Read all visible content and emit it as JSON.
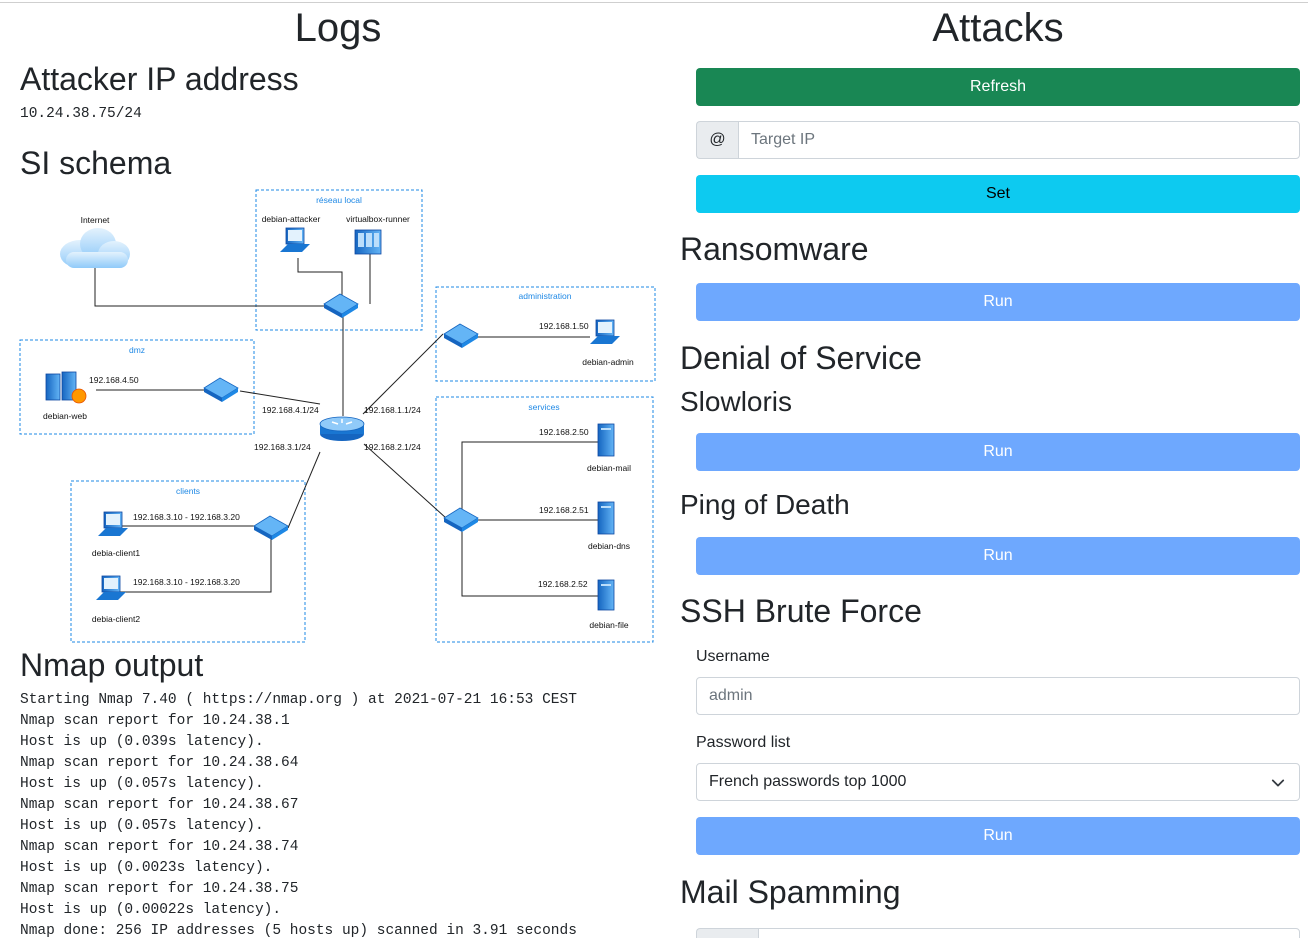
{
  "logs": {
    "title": "Logs",
    "attacker_heading": "Attacker IP address",
    "attacker_ip": "10.24.38.75/24",
    "schema_heading": "SI schema",
    "nmap_heading": "Nmap output",
    "nmap_lines": [
      "Starting Nmap 7.40 ( https://nmap.org ) at 2021-07-21 16:53 CEST",
      "Nmap scan report for 10.24.38.1",
      "Host is up (0.039s latency).",
      "Nmap scan report for 10.24.38.64",
      "Host is up (0.057s latency).",
      "Nmap scan report for 10.24.38.67",
      "Host is up (0.057s latency).",
      "Nmap scan report for 10.24.38.74",
      "Host is up (0.0023s latency).",
      "Nmap scan report for 10.24.38.75",
      "Host is up (0.00022s latency).",
      "Nmap done: 256 IP addresses (5 hosts up) scanned in 3.91 seconds"
    ]
  },
  "schema": {
    "zones": {
      "local": "réseau local",
      "administration": "administration",
      "dmz": "dmz",
      "services": "services",
      "clients": "clients"
    },
    "nodes": {
      "internet": "Internet",
      "attacker": "debian-attacker",
      "runner": "virtualbox-runner",
      "admin": "debian-admin",
      "web": "debian-web",
      "mail": "debian-mail",
      "dns": "debian-dns",
      "file": "debian-file",
      "client1": "debia-client1",
      "client2": "debia-client2"
    },
    "ips": {
      "admin": "192.168.1.50",
      "web": "192.168.4.50",
      "mail": "192.168.2.50",
      "dns": "192.168.2.51",
      "file": "192.168.2.52",
      "client1": "192.168.3.10 - 192.168.3.20",
      "client2": "192.168.3.10 - 192.168.3.20",
      "router_dmz": "192.168.4.1/24",
      "router_admin": "192.168.1.1/24",
      "router_clients": "192.168.3.1/24",
      "router_services": "192.168.2.1/24"
    }
  },
  "attacks": {
    "title": "Attacks",
    "refresh_label": "Refresh",
    "target_addon": "@",
    "target_placeholder": "Target IP",
    "set_label": "Set",
    "ransomware_heading": "Ransomware",
    "run_label": "Run",
    "dos_heading": "Denial of Service",
    "slowloris_heading": "Slowloris",
    "ping_heading": "Ping of Death",
    "ssh_heading": "SSH Brute Force",
    "username_label": "Username",
    "username_placeholder": "admin",
    "password_label": "Password list",
    "password_selected": "French passwords top 1000",
    "mail_heading": "Mail Spamming"
  },
  "colors": {
    "success": "#198754",
    "info": "#0dcaf0",
    "primary_light": "#6ea8fe",
    "diagram_blue": "#1e88e5"
  },
  "icons": [
    "cloud-icon",
    "laptop-icon",
    "server-icon",
    "switch-icon",
    "router-icon",
    "chevron-down-icon"
  ]
}
